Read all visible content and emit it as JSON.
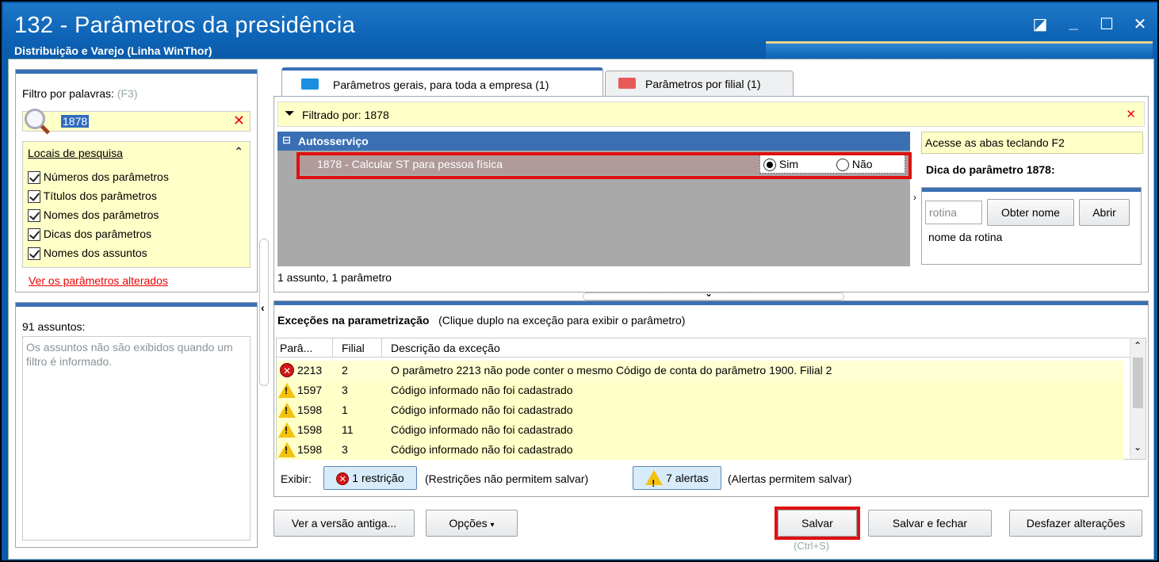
{
  "window": {
    "title": "132 - Parâmetros da presidência",
    "subtitle": "Distribuição e Varejo (Linha WinThor)",
    "controls": [
      "restore-icon",
      "minimize-icon",
      "maximize-icon",
      "close-icon"
    ]
  },
  "filter": {
    "label": "Filtro por palavras:",
    "shortcut": "(F3)",
    "value": "1878",
    "locais_title": "Locais de pesquisa",
    "locais": [
      "Números dos parâmetros",
      "Títulos dos parâmetros",
      "Nomes dos parâmetros",
      "Dicas dos parâmetros",
      "Nomes dos assuntos"
    ],
    "changed_link": "Ver os parâmetros alterados"
  },
  "subjects": {
    "count_label": "91 assuntos:",
    "message": "Os assuntos não são exibidos quando um filtro é informado."
  },
  "tabs": [
    {
      "label": "Parâmetros gerais, para toda a empresa",
      "count": "(1)"
    },
    {
      "label": "Parâmetros por filial",
      "count": "(1)"
    }
  ],
  "filtered": {
    "text": "Filtrado por: 1878"
  },
  "group": {
    "title": "Autosserviço",
    "param_label": "1878 - Calcular ST para pessoa física",
    "opt_yes": "Sim",
    "opt_no": "Não",
    "selected": "Sim"
  },
  "summary": "1 assunto, 1 parâmetro",
  "tip": {
    "hint": "Acesse as abas teclando F2",
    "title": "Dica do parâmetro 1878:",
    "rotina_placeholder": "rotina",
    "obter_nome": "Obter nome",
    "abrir": "Abrir",
    "nome_rotina": "nome da rotina"
  },
  "exceptions": {
    "title": "Exceções na parametrização",
    "hint": "(Clique duplo na exceção para exibir o parâmetro)",
    "columns": [
      "Parâ...",
      "Filial",
      "Descrição da exceção"
    ],
    "rows": [
      {
        "icon": "error",
        "param": "2213",
        "filial": "2",
        "desc": "O parâmetro 2213 não pode conter o mesmo Código de conta do parâmetro 1900. Filial 2"
      },
      {
        "icon": "warning",
        "param": "1597",
        "filial": "3",
        "desc": "Código informado não foi cadastrado"
      },
      {
        "icon": "warning",
        "param": "1598",
        "filial": "1",
        "desc": "Código informado não foi cadastrado"
      },
      {
        "icon": "warning",
        "param": "1598",
        "filial": "11",
        "desc": "Código informado não foi cadastrado"
      },
      {
        "icon": "warning",
        "param": "1598",
        "filial": "3",
        "desc": "Código informado não foi cadastrado"
      }
    ],
    "exibir_label": "Exibir:",
    "restricoes_btn": "1 restrição",
    "restricoes_note": "(Restrições não permitem salvar)",
    "alertas_btn": "7 alertas",
    "alertas_note": "(Alertas permitem salvar)"
  },
  "footer": {
    "versao_antiga": "Ver a versão antiga...",
    "opcoes": "Opções",
    "salvar": "Salvar",
    "salvar_shortcut": "(Ctrl+S)",
    "salvar_fechar": "Salvar e fechar",
    "desfazer": "Desfazer alterações"
  },
  "colors": {
    "title_blue": "#0d63b6",
    "highlight_red": "#e01010",
    "yellow_bg": "#ffffc8",
    "group_header": "#3a6fb4"
  }
}
